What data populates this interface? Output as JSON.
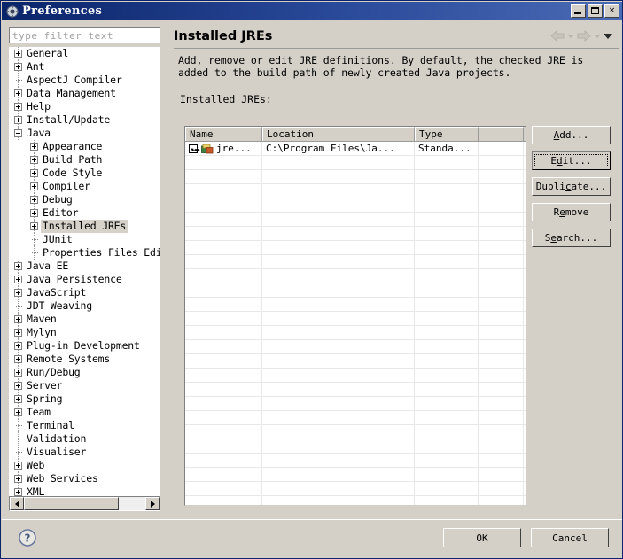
{
  "window": {
    "title": "Preferences",
    "icon": "gear-icon",
    "controls": {
      "minimize": "minimize-icon",
      "maximize": "maximize-icon",
      "close": "×"
    },
    "titlebar_color": "#0a246a",
    "chrome_color": "#d4d0c8"
  },
  "sidebar": {
    "filter": {
      "placeholder": "type filter text",
      "value": ""
    },
    "items": [
      {
        "label": "General",
        "depth": 0,
        "state": "collapsed"
      },
      {
        "label": "Ant",
        "depth": 0,
        "state": "collapsed"
      },
      {
        "label": "AspectJ Compiler",
        "depth": 0,
        "state": "leaf"
      },
      {
        "label": "Data Management",
        "depth": 0,
        "state": "collapsed"
      },
      {
        "label": "Help",
        "depth": 0,
        "state": "collapsed"
      },
      {
        "label": "Install/Update",
        "depth": 0,
        "state": "collapsed"
      },
      {
        "label": "Java",
        "depth": 0,
        "state": "expanded"
      },
      {
        "label": "Appearance",
        "depth": 1,
        "state": "collapsed"
      },
      {
        "label": "Build Path",
        "depth": 1,
        "state": "collapsed"
      },
      {
        "label": "Code Style",
        "depth": 1,
        "state": "collapsed"
      },
      {
        "label": "Compiler",
        "depth": 1,
        "state": "collapsed"
      },
      {
        "label": "Debug",
        "depth": 1,
        "state": "collapsed"
      },
      {
        "label": "Editor",
        "depth": 1,
        "state": "collapsed"
      },
      {
        "label": "Installed JREs",
        "depth": 1,
        "state": "collapsed",
        "selected": true
      },
      {
        "label": "JUnit",
        "depth": 1,
        "state": "leaf"
      },
      {
        "label": "Properties Files Edit",
        "depth": 1,
        "state": "leaf"
      },
      {
        "label": "Java EE",
        "depth": 0,
        "state": "collapsed"
      },
      {
        "label": "Java Persistence",
        "depth": 0,
        "state": "collapsed"
      },
      {
        "label": "JavaScript",
        "depth": 0,
        "state": "collapsed"
      },
      {
        "label": "JDT Weaving",
        "depth": 0,
        "state": "leaf"
      },
      {
        "label": "Maven",
        "depth": 0,
        "state": "collapsed"
      },
      {
        "label": "Mylyn",
        "depth": 0,
        "state": "collapsed"
      },
      {
        "label": "Plug-in Development",
        "depth": 0,
        "state": "collapsed"
      },
      {
        "label": "Remote Systems",
        "depth": 0,
        "state": "collapsed"
      },
      {
        "label": "Run/Debug",
        "depth": 0,
        "state": "collapsed"
      },
      {
        "label": "Server",
        "depth": 0,
        "state": "collapsed"
      },
      {
        "label": "Spring",
        "depth": 0,
        "state": "collapsed"
      },
      {
        "label": "Team",
        "depth": 0,
        "state": "collapsed"
      },
      {
        "label": "Terminal",
        "depth": 0,
        "state": "leaf"
      },
      {
        "label": "Validation",
        "depth": 0,
        "state": "leaf"
      },
      {
        "label": "Visualiser",
        "depth": 0,
        "state": "leaf"
      },
      {
        "label": "Web",
        "depth": 0,
        "state": "collapsed"
      },
      {
        "label": "Web Services",
        "depth": 0,
        "state": "collapsed"
      },
      {
        "label": "XML",
        "depth": 0,
        "state": "collapsed"
      }
    ],
    "scrollbar": {
      "left_arrow": "scroll-left-icon",
      "right_arrow": "scroll-right-icon"
    }
  },
  "page": {
    "title": "Installed JREs",
    "description": "Add, remove or edit JRE definitions. By default, the checked JRE is added to the build path of newly created Java projects.",
    "list_label": "Installed JREs:",
    "nav": {
      "back": "back-arrow-icon",
      "back_menu": "chevron-down-icon",
      "forward": "forward-arrow-icon",
      "forward_menu": "chevron-down-icon",
      "page_menu": "dropdown-triangle-icon"
    }
  },
  "table": {
    "columns": [
      "Name",
      "Location",
      "Type",
      ""
    ],
    "rows": [
      {
        "checked": true,
        "name": "jre...",
        "location": "C:\\Program Files\\Ja...",
        "type": "Standa...",
        "extra": ""
      }
    ],
    "empty_row_count": 25
  },
  "side_buttons": [
    {
      "label": "Add...",
      "mnemonic_index": 0,
      "focused": false
    },
    {
      "label": "Edit...",
      "mnemonic_index": 1,
      "focused": true
    },
    {
      "label": "Duplicate...",
      "mnemonic_index": 5,
      "focused": false
    },
    {
      "label": "Remove",
      "mnemonic_index": 1,
      "focused": false
    },
    {
      "label": "Search...",
      "mnemonic_index": 1,
      "focused": false
    }
  ],
  "footer": {
    "help": "help-icon",
    "ok_label": "OK",
    "cancel_label": "Cancel"
  }
}
